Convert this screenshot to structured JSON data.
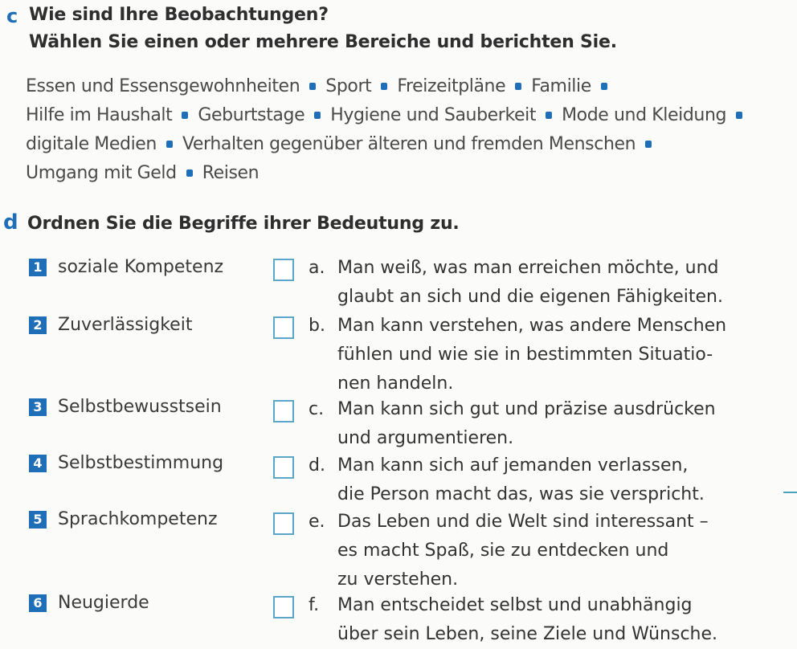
{
  "section_c": {
    "letter": "c",
    "title_line1": "Wie sind Ihre Beobachtungen?",
    "title_line2": "Wählen Sie einen oder mehrere Bereiche und berichten Sie.",
    "topics": [
      "Essen und Essensgewohnheiten",
      "Sport",
      "Freizeitpläne",
      "Familie",
      "Hilfe im Haushalt",
      "Geburtstage",
      "Hygiene und Sauberkeit",
      "Mode und Kleidung",
      "digitale Medien",
      "Verhalten gegenüber älteren und fremden Menschen",
      "Umgang mit Geld",
      "Reisen"
    ]
  },
  "section_d": {
    "letter": "d",
    "title": "Ordnen Sie die Begriffe ihrer Bedeutung zu.",
    "terms": [
      {
        "num": "1",
        "label": "soziale Kompetenz"
      },
      {
        "num": "2",
        "label": "Zuverlässigkeit"
      },
      {
        "num": "3",
        "label": "Selbstbewusstsein"
      },
      {
        "num": "4",
        "label": "Selbstbestimmung"
      },
      {
        "num": "5",
        "label": "Sprachkompetenz"
      },
      {
        "num": "6",
        "label": "Neugierde"
      }
    ],
    "definitions": [
      {
        "letter": "a.",
        "lines": [
          "Man weiß, was man erreichen möchte, und",
          "glaubt an sich und die eigenen Fähigkeiten."
        ]
      },
      {
        "letter": "b.",
        "lines": [
          "Man kann verstehen, was andere Menschen",
          "fühlen und wie sie in bestimmten Situatio-",
          "nen handeln."
        ]
      },
      {
        "letter": "c.",
        "lines": [
          "Man kann sich gut und präzise ausdrücken",
          "und argumentieren."
        ]
      },
      {
        "letter": "d.",
        "lines": [
          "Man kann sich auf jemanden verlassen,",
          "die Person macht das, was sie verspricht."
        ]
      },
      {
        "letter": "e.",
        "lines": [
          "Das Leben und die Welt sind interessant –",
          "es macht Spaß, sie zu entdecken und",
          "zu verstehen."
        ]
      },
      {
        "letter": "f.",
        "lines": [
          "Man entscheidet selbst und unabhängig",
          "über sein Leben, seine Ziele und Wünsche."
        ]
      }
    ]
  },
  "colors": {
    "accent": "#1f6fb8",
    "checkbox_border": "#5aa7c7"
  }
}
